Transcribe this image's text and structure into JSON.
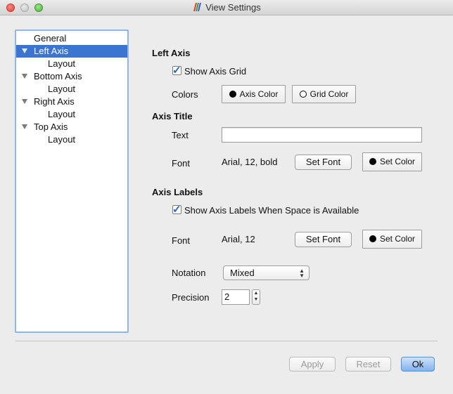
{
  "window": {
    "title": "View Settings"
  },
  "sidebar": {
    "items": [
      {
        "label": "General"
      },
      {
        "label": "Left Axis"
      },
      {
        "label": "Layout"
      },
      {
        "label": "Bottom Axis"
      },
      {
        "label": "Layout"
      },
      {
        "label": "Right Axis"
      },
      {
        "label": "Layout"
      },
      {
        "label": "Top Axis"
      },
      {
        "label": "Layout"
      }
    ],
    "selected": "Left Axis"
  },
  "left_axis": {
    "heading": "Left Axis",
    "show_grid_label": "Show Axis Grid",
    "show_grid_checked": true,
    "colors_label": "Colors",
    "axis_color_button": "Axis Color",
    "grid_color_button": "Grid Color"
  },
  "axis_title": {
    "heading": "Axis Title",
    "text_label": "Text",
    "text_value": "",
    "font_label": "Font",
    "font_value": "Arial, 12, bold",
    "set_font_button": "Set Font",
    "set_color_button": "Set Color"
  },
  "axis_labels": {
    "heading": "Axis Labels",
    "show_labels_label": "Show Axis Labels When Space is Available",
    "show_labels_checked": true,
    "font_label": "Font",
    "font_value": "Arial, 12",
    "set_font_button": "Set Font",
    "set_color_button": "Set Color",
    "notation_label": "Notation",
    "notation_value": "Mixed",
    "precision_label": "Precision",
    "precision_value": "2"
  },
  "footer": {
    "apply_button": "Apply",
    "reset_button": "Reset",
    "ok_button": "Ok"
  },
  "colors": {
    "selection": "#3a76d1",
    "focus_ring": "#8fb6e6",
    "close": "#e0443b",
    "maximize": "#4cb63c"
  }
}
